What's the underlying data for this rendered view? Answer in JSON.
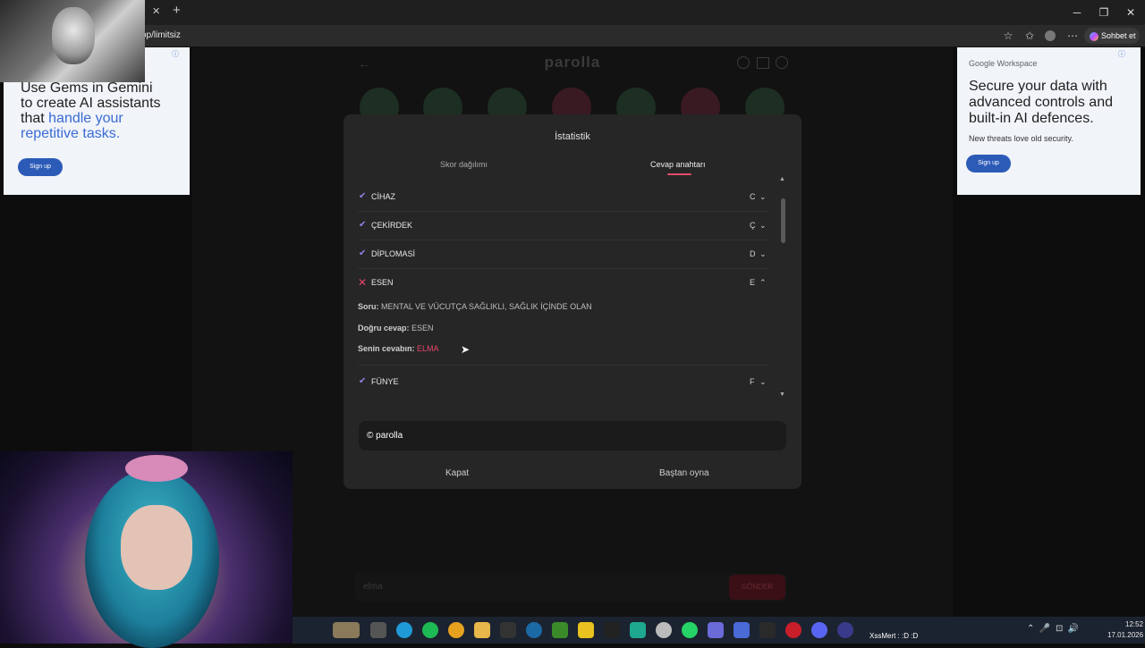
{
  "browser": {
    "url": "op/limitsiz",
    "copilot_label": "Sohbet et",
    "tab_close": "✕",
    "tab_new": "+"
  },
  "ads": {
    "left": {
      "line1": "Use Gems in Gemini",
      "line2": "to create AI assistants",
      "line3_prefix": "that ",
      "line3_link": "handle your",
      "line4_link": "repetitive tasks.",
      "button": "Sign up"
    },
    "right": {
      "brand": "Google Workspace",
      "line1": "Secure your data with",
      "line2": "advanced controls and",
      "line3": "built-in AI defences.",
      "sub": "New threats love old security.",
      "button": "Sign up"
    }
  },
  "app": {
    "brand": "parolla"
  },
  "modal": {
    "title": "İstatistik",
    "tabs": [
      "Skor dağılımı",
      "Cevap anahtarı"
    ],
    "active_tab": "Cevap anahtarı",
    "rows": [
      {
        "word": "CİHAZ",
        "letter": "C",
        "status": "correct"
      },
      {
        "word": "ÇEKİRDEK",
        "letter": "Ç",
        "status": "correct"
      },
      {
        "word": "DİPLOMASİ",
        "letter": "D",
        "status": "correct"
      },
      {
        "word": "ESEN",
        "letter": "E",
        "status": "wrong"
      },
      {
        "word": "FÜNYE",
        "letter": "F",
        "status": "correct"
      }
    ],
    "detail": {
      "question_label": "Soru:",
      "question": "MENTAL VE VÜCUTÇA SAĞLIKLI, SAĞLIK İÇİNDE OLAN",
      "correct_label": "Doğru cevap:",
      "correct": "ESEN",
      "yours_label": "Senin cevabın:",
      "yours": "ELMA"
    },
    "copyright": "© parolla",
    "close_button": "Kapat",
    "restart_button": "Baştan oyna"
  },
  "game": {
    "input_value": "elma",
    "send_label": "GÖNDER"
  },
  "system": {
    "time": "12:52",
    "date": "17.01.2026",
    "streamer_tag": "XssMert : :D :D"
  },
  "colors": {
    "accent": "#e24c6a",
    "check": "#8b83e8",
    "modal_bg": "#262626",
    "ad_blue": "#2c5bb7"
  }
}
